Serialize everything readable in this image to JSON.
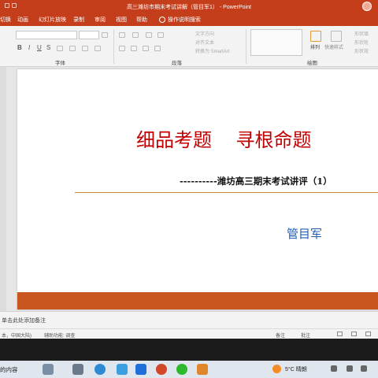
{
  "window": {
    "title": "高三潍坊市期末考试讲解（管目军1） - PowerPoint",
    "accent_color": "#c43e1c"
  },
  "ribbon_tabs": [
    {
      "label": "切换"
    },
    {
      "label": "动画"
    },
    {
      "label": "幻灯片放映"
    },
    {
      "label": "录制"
    },
    {
      "label": "审阅"
    },
    {
      "label": "视图"
    },
    {
      "label": "帮助"
    },
    {
      "label": "操作说明搜索"
    }
  ],
  "ribbon": {
    "font_group_label": "字体",
    "paragraph_group_label": "段落",
    "drawing_group_label": "绘图",
    "format_bold": "B",
    "format_italic": "I",
    "format_underline": "U",
    "format_strike": "S",
    "text_direction": "文字方向",
    "align_text": "对齐文本",
    "smartart": "转换为 SmartArt",
    "arrange_label": "排列",
    "quick_styles_label": "快速样式",
    "shape_fill": "形状填",
    "shape_outline": "形状轮",
    "shape_effects": "形状效"
  },
  "slide": {
    "title": "细品考题    寻根命题",
    "subtitle": "----------潍坊高三期末考试讲评（1）",
    "author": "管目军",
    "title_color": "#c00000",
    "author_color": "#1f5fb0",
    "band_color": "#c9561f"
  },
  "notes": {
    "placeholder": "单击此处添加备注"
  },
  "statusbar": {
    "language": "本，中国大陆)",
    "accessibility": "辅助功能: 调查",
    "notes_button": "备注",
    "comments_button": "批注"
  },
  "taskbar": {
    "search_text": "的内容",
    "weather": "5°C  晴朗",
    "icons": [
      "task-view-icon",
      "edge-icon",
      "store-icon",
      "powerpoint-icon",
      "wechat-icon",
      "app-icon"
    ]
  }
}
